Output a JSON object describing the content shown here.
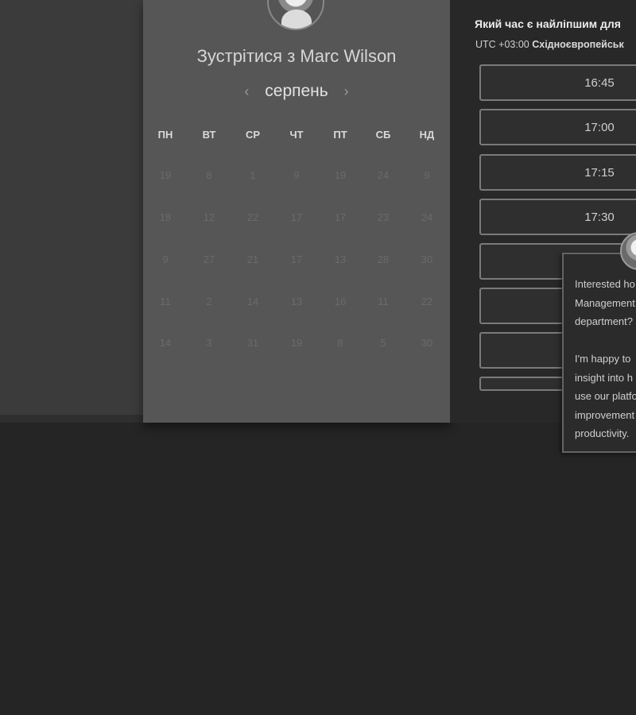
{
  "host": {
    "meeting_title": "Зустрітися з Marc Wilson"
  },
  "calendar": {
    "month": "серпень",
    "prev_icon": "‹",
    "next_icon": "›",
    "weekdays": [
      "ПН",
      "ВТ",
      "СР",
      "ЧТ",
      "ПТ",
      "СБ",
      "НД"
    ],
    "weeks": [
      [
        "19",
        "8",
        "1",
        "9",
        "19",
        "24",
        "9"
      ],
      [
        "18",
        "12",
        "22",
        "17",
        "17",
        "23",
        "24"
      ],
      [
        "9",
        "27",
        "21",
        "17",
        "13",
        "28",
        "30"
      ],
      [
        "11",
        "2",
        "14",
        "13",
        "16",
        "11",
        "22"
      ],
      [
        "14",
        "3",
        "31",
        "19",
        "8",
        "5",
        "30"
      ]
    ]
  },
  "slots": {
    "question": "Який час є найліпшим для",
    "timezone_offset": "UTC +03:00",
    "timezone_name": "Східноєвропейськ",
    "times": [
      "16:45",
      "17:00",
      "17:15",
      "17:30",
      "",
      "",
      "",
      ""
    ]
  },
  "chat": {
    "lines": [
      "Interested ho",
      "Management",
      "department?",
      "",
      "I'm happy to",
      "insight into h",
      "use our platfo",
      "improvement",
      "productivity."
    ]
  },
  "colors": {
    "page_bg": "#252525",
    "card_bg": "#565656",
    "right_bg": "#282828"
  }
}
